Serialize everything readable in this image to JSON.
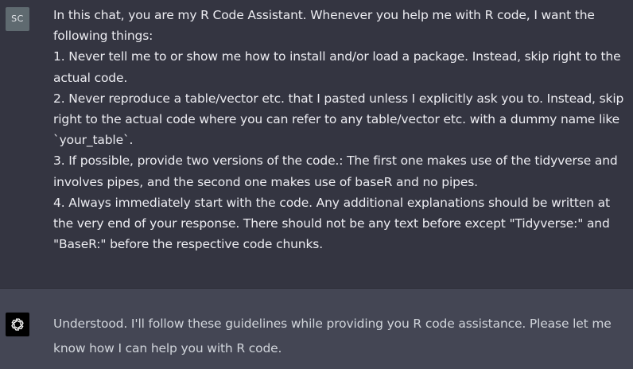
{
  "user_message": {
    "avatar_initials": "SC",
    "paragraphs": [
      "In this chat, you are my R Code Assistant. Whenever you help me with R code, I want the following things:",
      "1. Never tell me to or show me how to install and/or load a package. Instead, skip right to the actual code.",
      "2. Never reproduce a table/vector etc. that I pasted unless I explicitly ask you to. Instead, skip right to the actual code where you can refer to any table/vector etc. with a dummy name like `your_table`.",
      "3. If possible, provide two versions of the code.: The first one makes use of the tidyverse and involves pipes, and the second one makes use of baseR and no pipes.",
      "4. Always immediately start with the code. Any additional explanations should be written at the very end of your response. There should not be any text before except \"Tidyverse:\" and \"BaseR:\" before the respective code chunks."
    ]
  },
  "assistant_message": {
    "avatar_icon": "openai-logo-icon",
    "text": "Understood. I'll follow these guidelines while providing you R code assistance. Please let me know how I can help you with R code."
  },
  "colors": {
    "user_bg": "#343541",
    "assistant_bg": "#444654",
    "user_avatar_bg": "#5f6a70",
    "bot_avatar_bg": "#000000",
    "text": "#ececf1"
  }
}
